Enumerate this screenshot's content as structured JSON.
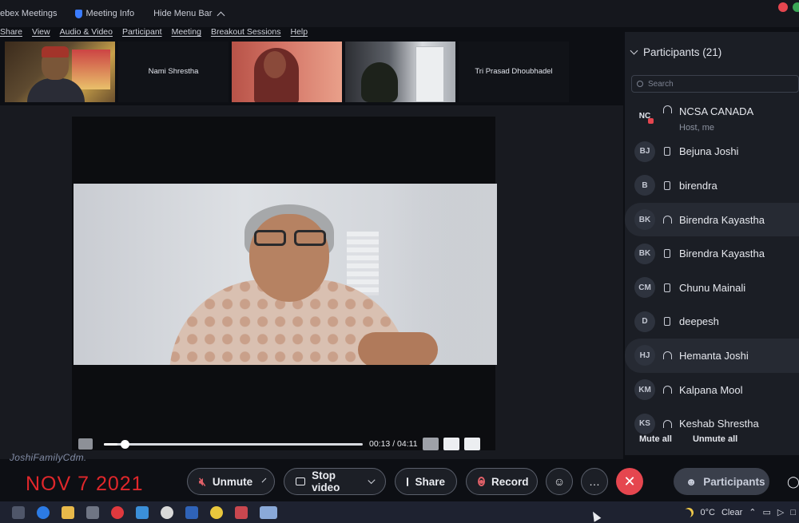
{
  "titlebar": {
    "app_name": "ebex Meetings",
    "meeting_info": "Meeting Info",
    "hide_menu": "Hide Menu Bar"
  },
  "menu": [
    "Share",
    "View",
    "Audio & Video",
    "Participant",
    "Meeting",
    "Breakout Sessions",
    "Help"
  ],
  "thumbnails": [
    {
      "name": "",
      "kind": "video"
    },
    {
      "name": "Nami Shrestha",
      "kind": "name"
    },
    {
      "name": "",
      "kind": "video"
    },
    {
      "name": "",
      "kind": "video"
    },
    {
      "name": "Tri Prasad Dhoubhadel",
      "kind": "name"
    }
  ],
  "player": {
    "current": "00:13",
    "separator": " / ",
    "total": "04:11",
    "progress_fraction": 0.052
  },
  "watermark": "JoshiFamilyCdm.",
  "date_stamp": "NOV 7 2021",
  "controls": {
    "unmute": "Unmute",
    "stop_video": "Stop video",
    "share": "Share",
    "record": "Record",
    "participants": "Participants"
  },
  "panel": {
    "title": "Participants (21)",
    "search_placeholder": "Search",
    "mute_all": "Mute all",
    "unmute_all": "Unmute all",
    "participants": [
      {
        "initials": "NC",
        "name": "NCSA CANADA",
        "sub": "Host, me",
        "device": "headset",
        "host": true
      },
      {
        "initials": "BJ",
        "name": "Bejuna Joshi",
        "device": "phone"
      },
      {
        "initials": "B",
        "name": "birendra",
        "device": "phone"
      },
      {
        "initials": "BK",
        "name": "Birendra Kayastha",
        "device": "headset",
        "highlight": true
      },
      {
        "initials": "BK",
        "name": "Birendra Kayastha",
        "device": "phone"
      },
      {
        "initials": "CM",
        "name": "Chunu Mainali",
        "device": "phone"
      },
      {
        "initials": "D",
        "name": "deepesh",
        "device": "phone"
      },
      {
        "initials": "HJ",
        "name": "Hemanta Joshi",
        "device": "headset",
        "highlight": true
      },
      {
        "initials": "KM",
        "name": "Kalpana Mool",
        "device": "headset"
      },
      {
        "initials": "KS",
        "name": "Keshab Shrestha",
        "device": "headset"
      }
    ]
  },
  "taskbar": {
    "temperature": "0°C",
    "weather": "Clear"
  },
  "colors": {
    "leave_red": "#e5464f",
    "date_red": "#e0272b",
    "panel_bg": "#1b1e25"
  }
}
